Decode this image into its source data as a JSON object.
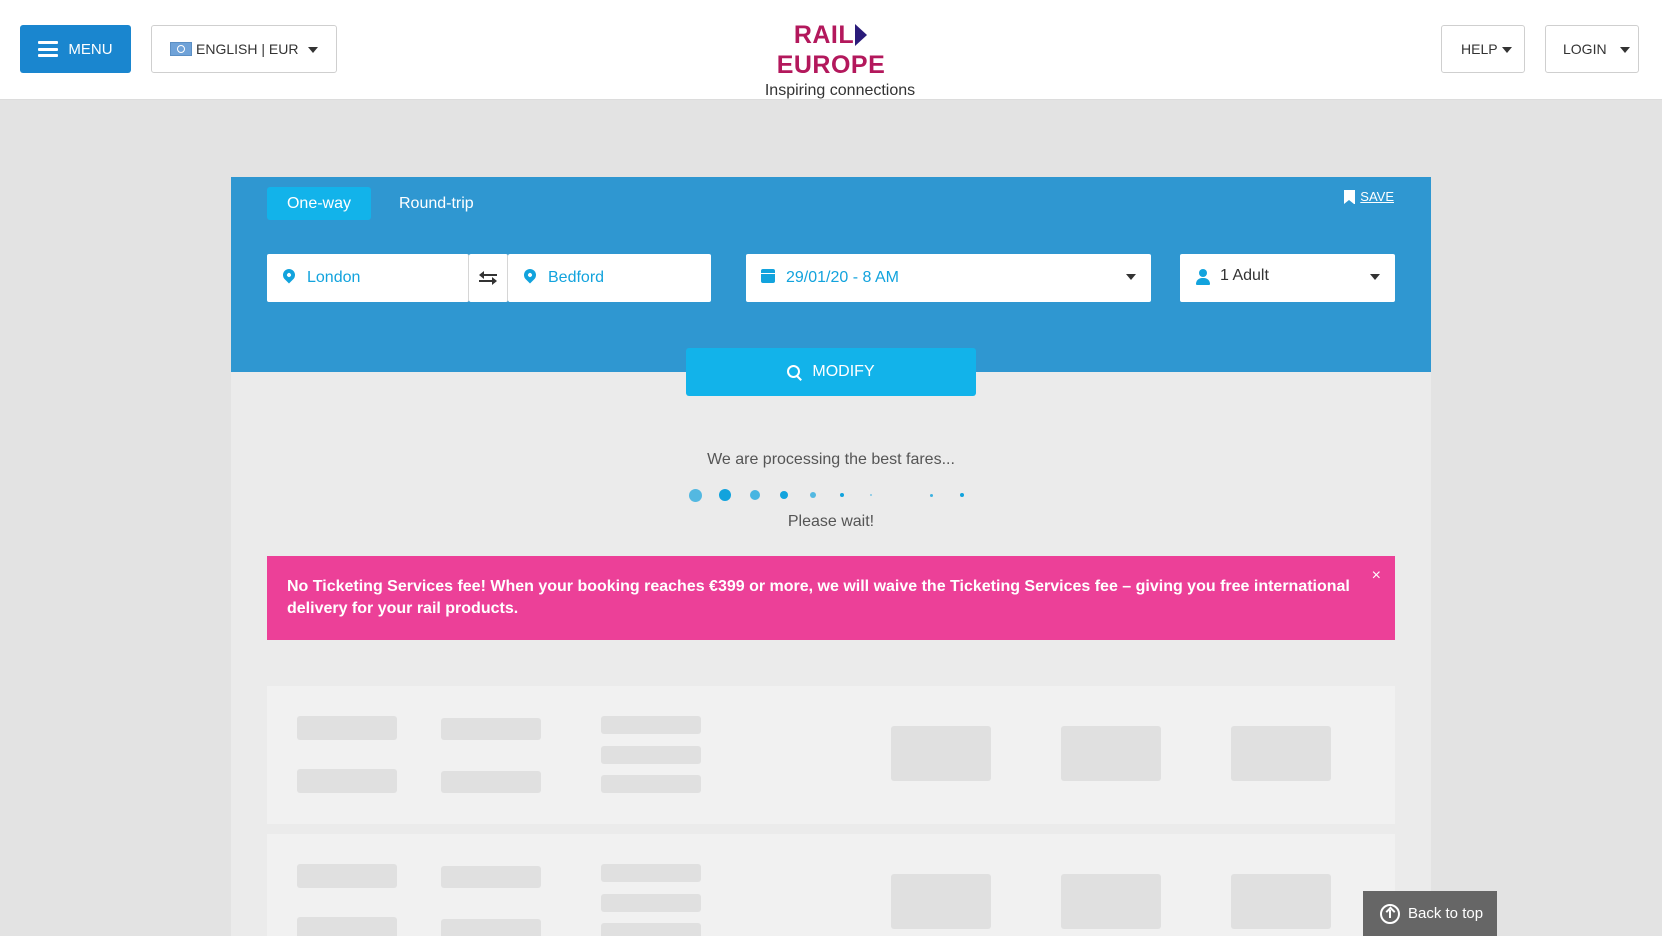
{
  "header": {
    "menu_label": "MENU",
    "language_label": "ENGLISH | EUR",
    "logo_rail": "RAIL",
    "logo_europe": "EUROPE",
    "logo_tagline": "Inspiring connections",
    "help_label": "HELP",
    "login_label": "LOGIN"
  },
  "search": {
    "tabs": [
      {
        "label": "One-way",
        "active": true
      },
      {
        "label": "Round-trip",
        "active": false
      }
    ],
    "save_label": "SAVE",
    "origin": "London",
    "destination": "Bedford",
    "date_time": "29/01/20 - 8 AM",
    "passengers": "1 Adult",
    "modify_label": "MODIFY"
  },
  "status": {
    "processing_text": "We are processing the best fares...",
    "wait_text": "Please wait!"
  },
  "promo": {
    "text": "No Ticketing Services fee! When your booking reaches €399 or more, we will waive the Ticketing Services fee – giving you free international delivery for your rail products.",
    "close_label": "×"
  },
  "footer": {
    "back_to_top_label": "Back to top"
  },
  "colors": {
    "primary_blue": "#2f97d1",
    "accent_cyan": "#12b3ea",
    "menu_blue": "#1a86cf",
    "promo_pink": "#ec4098",
    "brand_magenta": "#b3185c"
  },
  "icons": [
    "hamburger-icon",
    "flag-icon",
    "pin-icon",
    "swap-icon",
    "calendar-icon",
    "user-icon",
    "bookmark-icon",
    "search-icon",
    "arrow-up-icon",
    "close-icon"
  ]
}
